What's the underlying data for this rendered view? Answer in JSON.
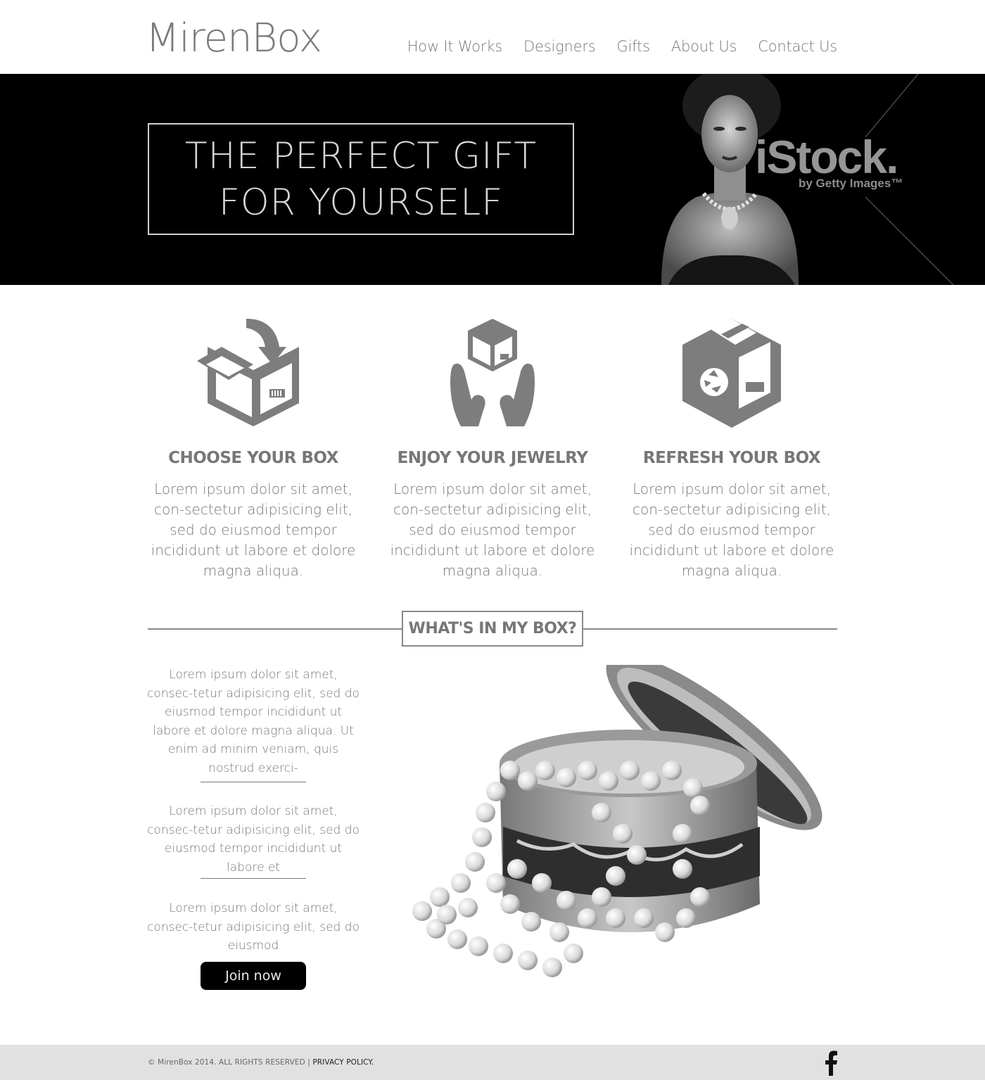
{
  "brand": {
    "logo": "MirenBox"
  },
  "nav": [
    "How It Works",
    "Designers",
    "Gifts",
    "About Us",
    "Contact Us"
  ],
  "hero": {
    "line1": "THE PERFECT GIFT",
    "line2": "FOR YOURSELF",
    "watermark": "iStock.",
    "watermark_sub": "by Getty Images™"
  },
  "features": [
    {
      "title": "CHOOSE YOUR BOX",
      "text": "Lorem ipsum dolor sit amet, con-sectetur adipisicing elit, sed do eiusmod tempor incididunt ut labore et dolore magna aliqua."
    },
    {
      "title": "ENJOY YOUR JEWELRY",
      "text": "Lorem ipsum dolor sit amet, con-sectetur adipisicing elit, sed do eiusmod tempor incididunt ut labore et dolore magna aliqua."
    },
    {
      "title": "REFRESH YOUR BOX",
      "text": "Lorem ipsum dolor sit amet, con-sectetur adipisicing elit, sed do eiusmod tempor incididunt ut labore et dolore magna aliqua."
    }
  ],
  "section": {
    "title": "WHAT'S IN MY BOX?",
    "paragraphs": [
      "Lorem ipsum dolor sit amet, consec-tetur adipisicing elit, sed do eiusmod tempor incididunt ut labore et dolore magna aliqua. Ut enim ad minim veniam, quis nostrud exerci-",
      "Lorem ipsum dolor sit amet, consec-tetur adipisicing elit, sed do eiusmod tempor incididunt ut labore et",
      "Lorem ipsum dolor sit amet, consec-tetur adipisicing elit, sed do eiusmod"
    ],
    "cta": "Join now"
  },
  "footer": {
    "copyright": "© MirenBox 2014. ALL RIGHTS RESERVED |",
    "policy": "PRIVACY POLICY.",
    "social_icon": "facebook-icon"
  },
  "colors": {
    "icon_gray": "#7d7d7d",
    "hero_bg": "#000000",
    "footer_bg": "#e1e1e1",
    "button_bg": "#000000"
  }
}
